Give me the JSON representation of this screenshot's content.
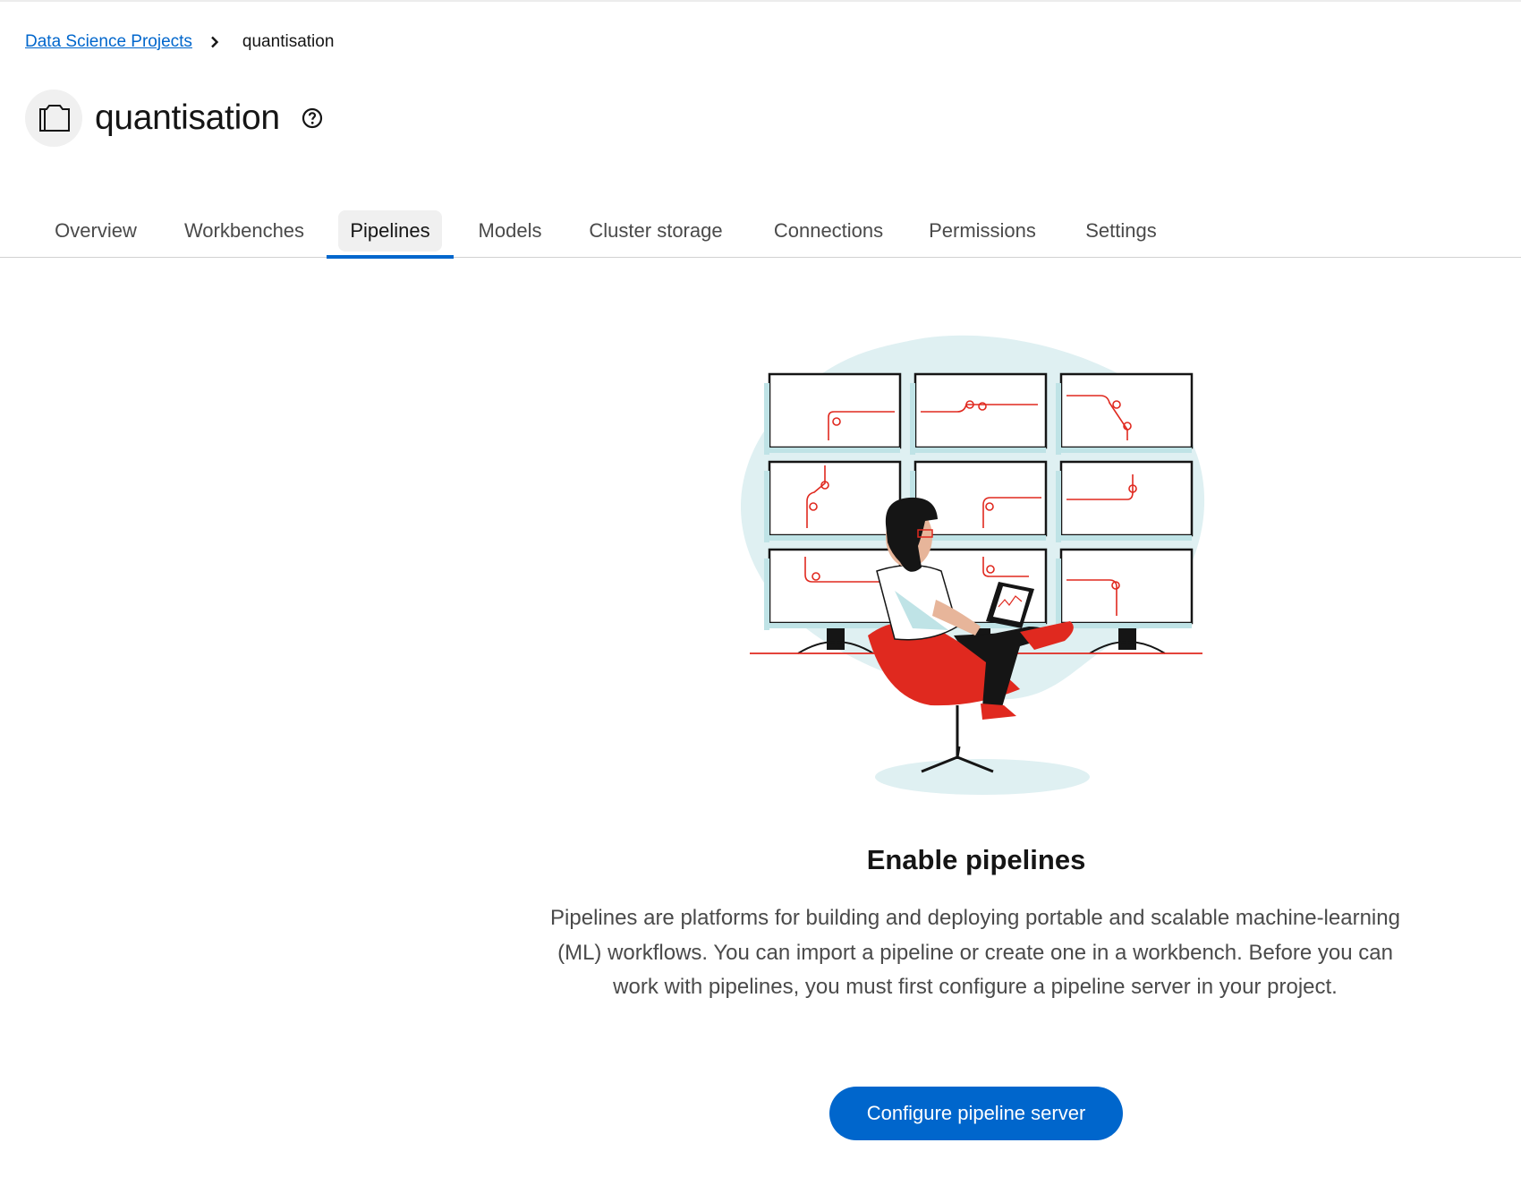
{
  "breadcrumb": {
    "parent_label": "Data Science Projects",
    "current_label": "quantisation"
  },
  "header": {
    "title": "quantisation",
    "project_icon": "folder-icon",
    "help_icon": "question-circle-icon"
  },
  "tabs": [
    {
      "label": "Overview",
      "active": false
    },
    {
      "label": "Workbenches",
      "active": false
    },
    {
      "label": "Pipelines",
      "active": true
    },
    {
      "label": "Models",
      "active": false
    },
    {
      "label": "Cluster storage",
      "active": false
    },
    {
      "label": "Connections",
      "active": false
    },
    {
      "label": "Permissions",
      "active": false
    },
    {
      "label": "Settings",
      "active": false
    }
  ],
  "empty_state": {
    "illustration": "person-with-laptop-monitors-illustration",
    "title": "Enable pipelines",
    "description": "Pipelines are platforms for building and deploying portable and scalable machine-learning (ML) workflows. You can import a pipeline or create one in a workbench. Before you can work with pipelines, you must first configure a pipeline server in your project.",
    "button_label": "Configure pipeline server"
  },
  "colors": {
    "link": "#0066cc",
    "primary": "#0066cc",
    "accent_red": "#e0291f",
    "illustration_teal": "#dff0f2"
  }
}
